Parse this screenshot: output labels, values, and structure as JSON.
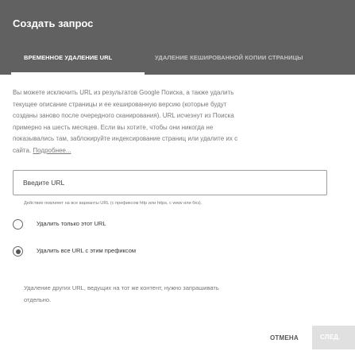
{
  "dialog": {
    "title": "Создать запрос"
  },
  "tabs": [
    {
      "label": "ВРЕМЕННОЕ УДАЛЕНИЕ URL",
      "active": true
    },
    {
      "label": "УДАЛЕНИЕ КЕШИРОВАННОЙ КОПИИ СТРАНИЦЫ",
      "active": false
    }
  ],
  "description": {
    "lines": [
      "Вы можете исключить URL из результатов Google Поиска, а также удалить",
      "текущее описание страницы и ее кешированную версию (которые будут",
      "созданы заново после очередного сканирования). URL исчезнут из Поиска",
      "примерно на шесть месяцев. Если вы хотите, чтобы они никогда не",
      "показывались там, заблокируйте индексирование страниц или удалите их с"
    ],
    "last_line_prefix": "сайта. ",
    "more_link": "Подробнее..."
  },
  "url_input": {
    "placeholder": "Введите URL",
    "value": ""
  },
  "hint": "Действие повлияет на все варианты URL (с префиксом http или https, с www или без).",
  "radio_options": [
    {
      "label": "Удалить только этот URL",
      "selected": false
    },
    {
      "label": "Удалить все URL с этим префиксом",
      "selected": true
    }
  ],
  "note": {
    "line1": "Удаление других URL, ведущих на тот же контент, нужно запрашивать",
    "line2": "отдельно."
  },
  "actions": {
    "cancel_label": "ОТМЕНА",
    "next_label": "СЛЕД."
  },
  "colors": {
    "header_bg": "#616161",
    "next_button_bg": "#e0e0e0"
  }
}
